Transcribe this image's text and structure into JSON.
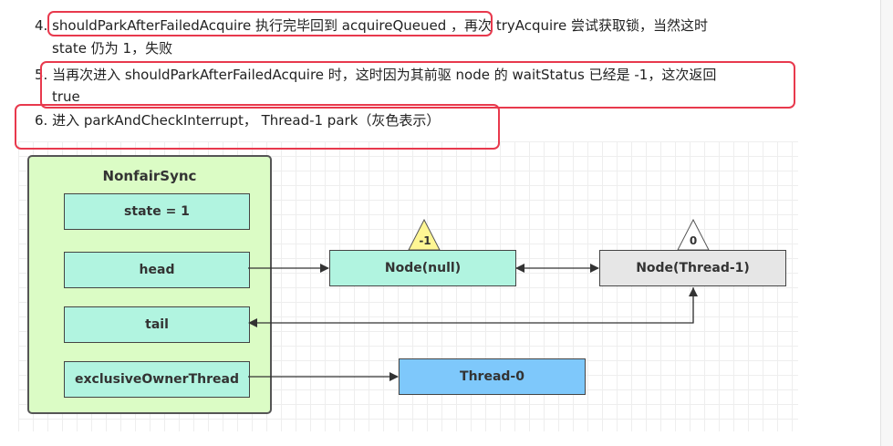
{
  "text": {
    "line1": "4. shouldParkAfterFailedAcquire 执行完毕回到 acquireQueued ，再次 tryAcquire 尝试获取锁，当然这时",
    "line1b": "state 仍为 1，失败",
    "line2": "5. 当再次进入 shouldParkAfterFailedAcquire 时，这时因为其前驱 node 的 waitStatus 已经是 -1，这次返回",
    "line2b": "true",
    "line3": "6. 进入 parkAndCheckInterrupt， Thread-1 park（灰色表示）"
  },
  "diagram": {
    "sync_title": "NonfairSync",
    "fields": {
      "state": "state = 1",
      "head": "head",
      "tail": "tail",
      "owner": "exclusiveOwnerThread"
    },
    "node_null": {
      "label": "Node(null)",
      "wait_status": "-1",
      "fill": "#b1f4e0",
      "badge_fill": "#fef694"
    },
    "node_thread1": {
      "label": "Node(Thread-1)",
      "wait_status": "0",
      "fill": "#e6e6e6",
      "badge_fill": "#ffffff"
    },
    "thread0": {
      "label": "Thread-0",
      "fill": "#7ec8fb"
    }
  },
  "colors": {
    "highlight": "#e8394d",
    "sync_bg": "#dbfcc5",
    "field_bg": "#b1f4e0"
  }
}
